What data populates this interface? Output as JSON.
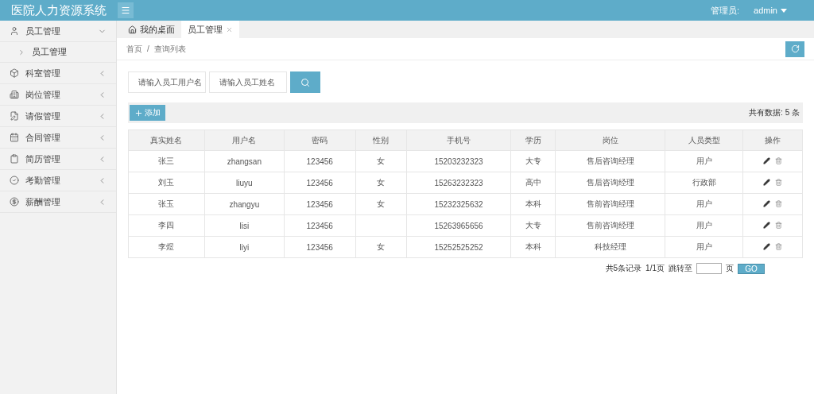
{
  "header": {
    "title": "医院人力资源系统",
    "user_label": "管理员:",
    "user_name": "admin"
  },
  "sidebar": {
    "items": [
      {
        "label": "员工管理",
        "expanded": true,
        "children": [
          {
            "label": "员工管理"
          }
        ]
      },
      {
        "label": "科室管理",
        "expanded": false
      },
      {
        "label": "岗位管理",
        "expanded": false
      },
      {
        "label": "请假管理",
        "expanded": false
      },
      {
        "label": "合同管理",
        "expanded": false
      },
      {
        "label": "简历管理",
        "expanded": false
      },
      {
        "label": "考勤管理",
        "expanded": false
      },
      {
        "label": "薪酬管理",
        "expanded": false
      }
    ]
  },
  "tabs": [
    {
      "label": "我的桌面",
      "selected": false,
      "closable": false
    },
    {
      "label": "员工管理",
      "selected": true,
      "closable": true
    }
  ],
  "breadcrumb": {
    "separator": "/",
    "items": [
      "首页",
      "查询列表"
    ]
  },
  "search": {
    "fields": [
      {
        "placeholder": "请输入员工用户名"
      },
      {
        "placeholder": "请输入员工姓名"
      }
    ]
  },
  "toolbar": {
    "add_label": "添加",
    "total": "共有数据: 5 条"
  },
  "table": {
    "columns": [
      "真实姓名",
      "用户名",
      "密码",
      "性别",
      "手机号",
      "学历",
      "岗位",
      "人员类型",
      "操作"
    ],
    "rows": [
      [
        "张三",
        "zhangsan",
        "123456",
        "女",
        "15203232323",
        "大专",
        "售后咨询经理",
        "用户"
      ],
      [
        "刘玉",
        "liuyu",
        "123456",
        "女",
        "15263232323",
        "高中",
        "售后咨询经理",
        "行政部"
      ],
      [
        "张玉",
        "zhangyu",
        "123456",
        "女",
        "15232325632",
        "本科",
        "售前咨询经理",
        "用户"
      ],
      [
        "李四",
        "lisi",
        "123456",
        "",
        "15263965656",
        "大专",
        "售前咨询经理",
        "用户"
      ],
      [
        "李煜",
        "liyi",
        "123456",
        "女",
        "15252525252",
        "本科",
        "科技经理",
        "用户"
      ]
    ]
  },
  "pagination": {
    "summary": "共5条记录",
    "pages": "1/1页",
    "jump_label": "跳转至",
    "page_unit": "页",
    "go": "GO"
  }
}
